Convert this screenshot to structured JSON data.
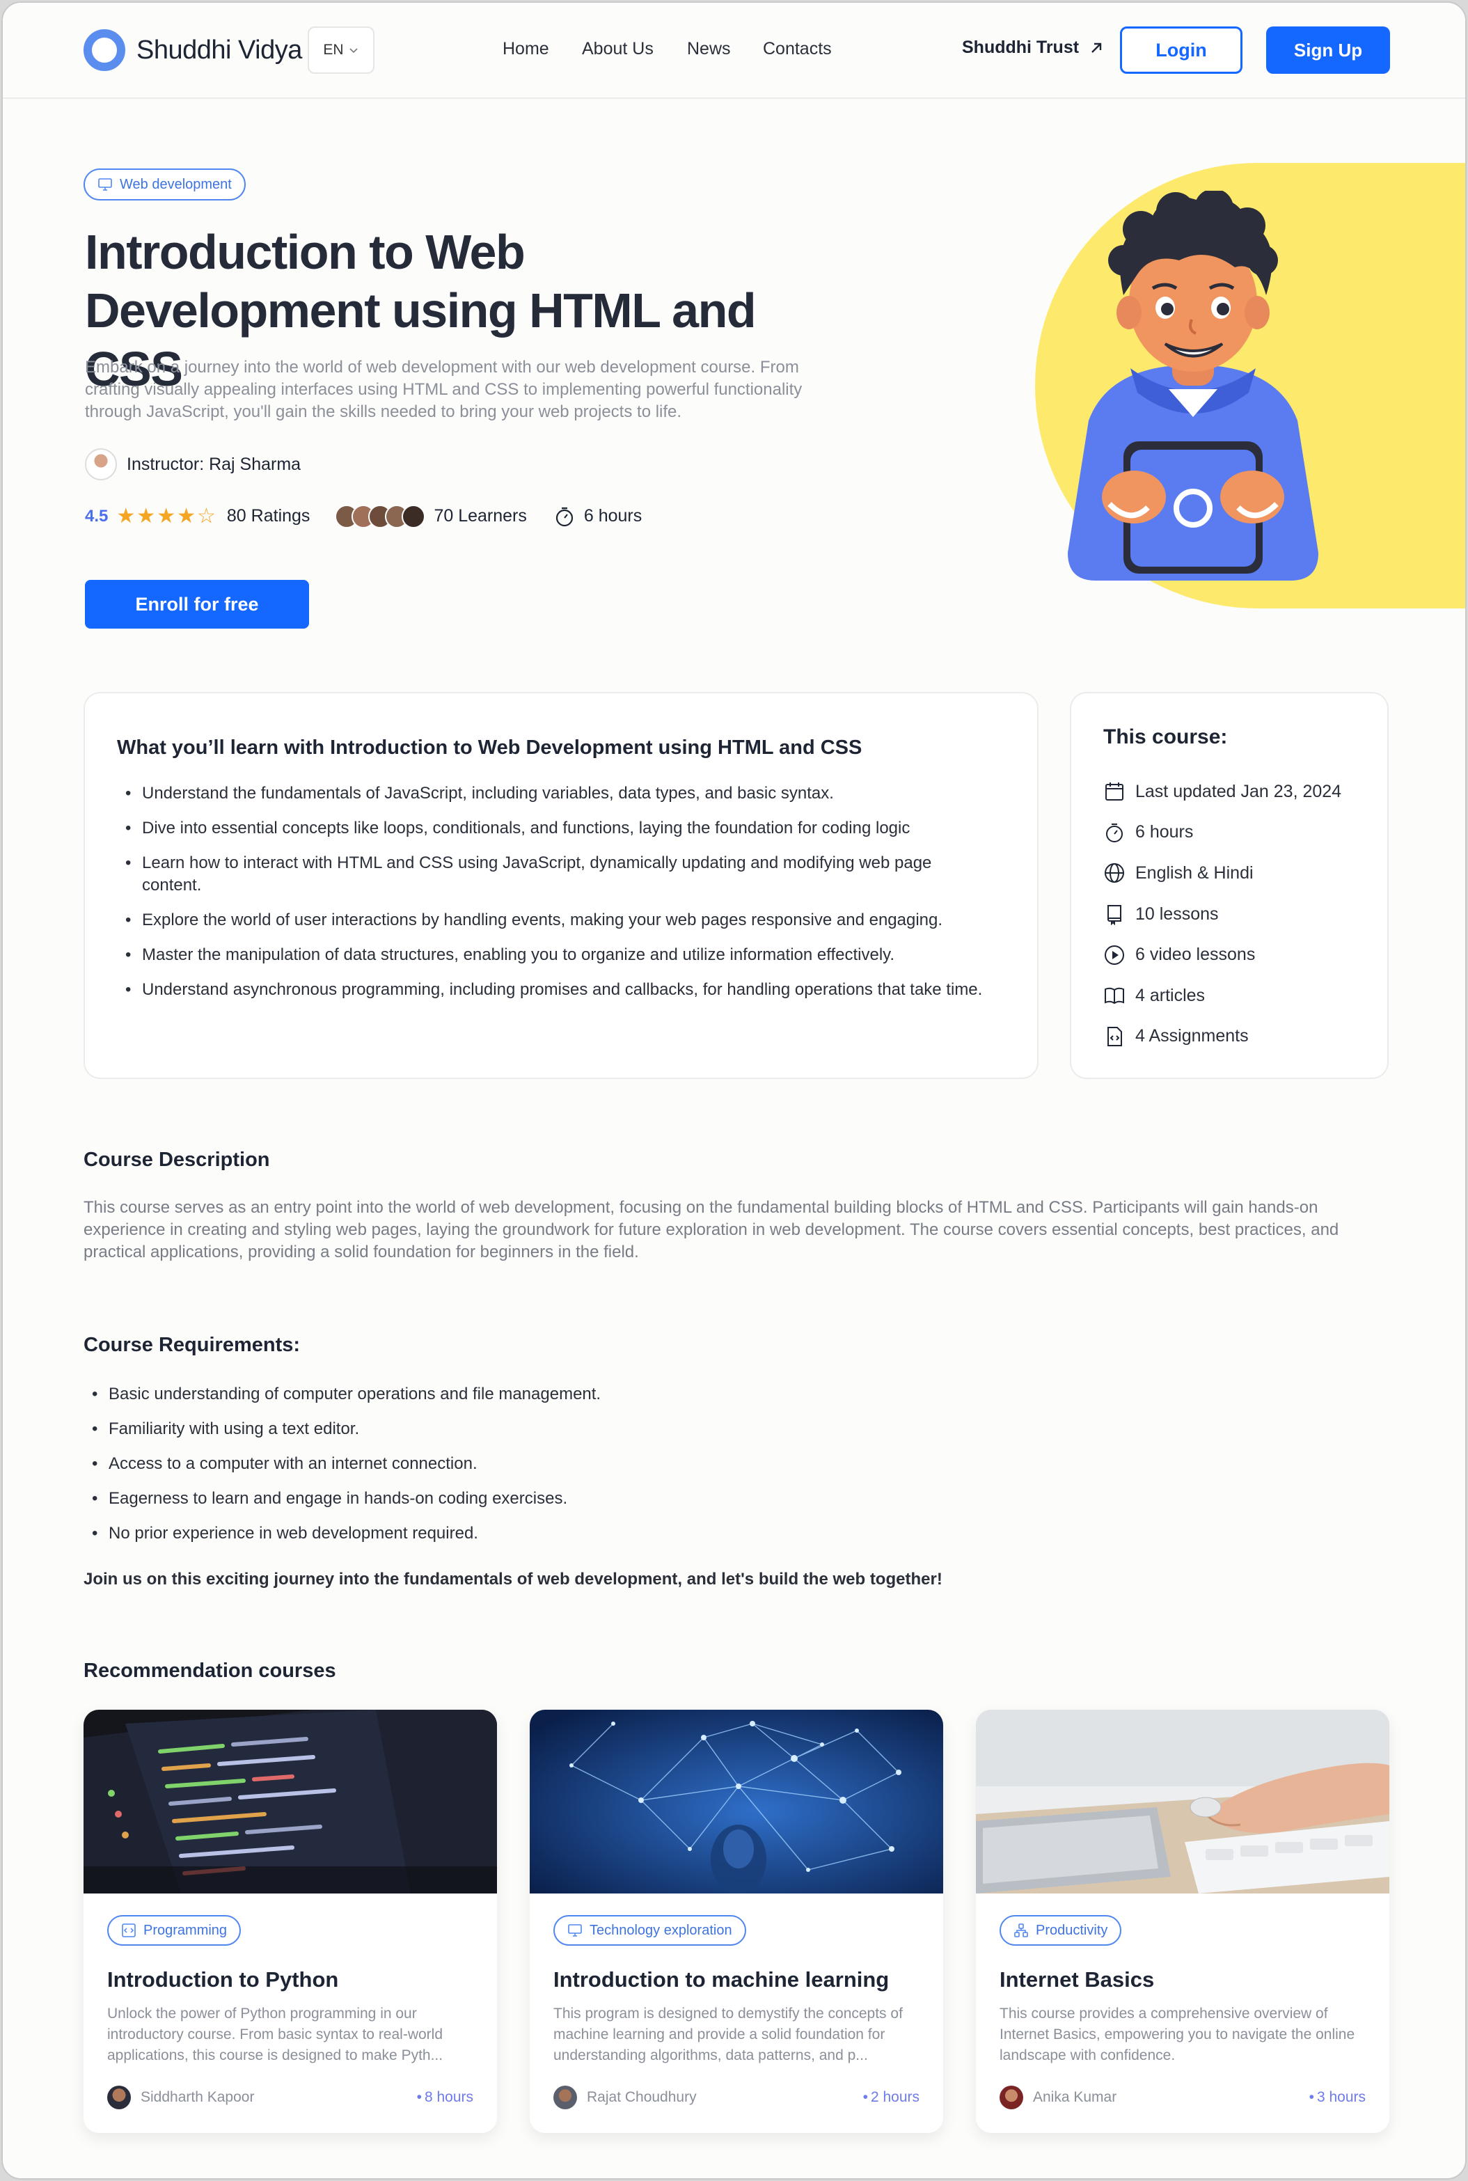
{
  "header": {
    "logo_text": "Shuddhi Vidya",
    "lang": "EN",
    "nav": [
      "Home",
      "About Us",
      "News",
      "Contacts"
    ],
    "trust_link": "Shuddhi Trust",
    "login": "Login",
    "signup": "Sign Up"
  },
  "hero": {
    "category": "Web development",
    "title": "Introduction to Web Development using HTML and CSS",
    "description": "Embark on a journey into the world of web development with our web development course. From crafting visually appealing interfaces using HTML and CSS to implementing powerful functionality through JavaScript, you'll gain the skills needed to bring your web projects to life.",
    "instructor": "Instructor: Raj Sharma",
    "rating": "4.5",
    "ratings_count": "80 Ratings",
    "learners": "70 Learners",
    "duration": "6 hours",
    "enroll": "Enroll for free"
  },
  "learn": {
    "title": "What you’ll learn with Introduction to Web Development using HTML and CSS",
    "items": [
      "Understand the fundamentals of JavaScript, including variables, data types, and basic syntax.",
      "Dive into essential concepts like loops, conditionals, and functions, laying the foundation for coding logic",
      "Learn how to interact with HTML and CSS using JavaScript, dynamically updating and modifying web page content.",
      "Explore the world of user interactions by handling events, making your web pages responsive and engaging.",
      "Master the manipulation of data structures, enabling you to organize and utilize information effectively.",
      "Understand asynchronous programming, including promises and callbacks, for handling operations that take time."
    ]
  },
  "course_info": {
    "title": "This course:",
    "items": [
      {
        "icon": "calendar-icon",
        "text": "Last updated Jan 23, 2024"
      },
      {
        "icon": "stopwatch-icon",
        "text": "6 hours"
      },
      {
        "icon": "globe-icon",
        "text": "English & Hindi"
      },
      {
        "icon": "book-icon",
        "text": "10 lessons"
      },
      {
        "icon": "play-icon",
        "text": "6 video lessons"
      },
      {
        "icon": "open-book-icon",
        "text": "4 articles"
      },
      {
        "icon": "code-file-icon",
        "text": "4 Assignments"
      }
    ]
  },
  "description": {
    "heading": "Course Description",
    "text": "This course serves as an entry point into the world of web development, focusing on the fundamental building blocks of HTML and CSS. Participants will gain hands-on experience in creating and styling web pages, laying the groundwork for future exploration in web development. The course covers essential concepts, best practices, and practical applications, providing a solid foundation for beginners in the field."
  },
  "requirements": {
    "heading": "Course Requirements:",
    "items": [
      "Basic understanding of computer operations and file management.",
      "Familiarity with using a text editor.",
      "Access to a computer with an internet connection.",
      "Eagerness to learn and engage in hands-on coding exercises.",
      "No prior experience in web development required."
    ],
    "closing": "Join us on this exciting journey into the fundamentals of web development, and let's build the web together!"
  },
  "recommendations": {
    "heading": "Recommendation courses",
    "cards": [
      {
        "tag": "Programming",
        "title": "Introduction to Python",
        "desc": "Unlock the power of Python programming in our introductory course. From basic syntax to real-world applications, this course is designed to make Pyth...",
        "author": "Siddharth Kapoor",
        "hours": "8 hours"
      },
      {
        "tag": "Technology exploration",
        "title": "Introduction to machine learning",
        "desc": "This program is designed to demystify the concepts of machine learning and provide a solid foundation for understanding algorithms, data patterns, and p...",
        "author": "Rajat Choudhury",
        "hours": "2 hours"
      },
      {
        "tag": "Productivity",
        "title": "Internet Basics",
        "desc": "This course provides a comprehensive overview of Internet Basics, empowering you to navigate the online landscape with confidence.",
        "author": "Anika Kumar",
        "hours": "3 hours"
      }
    ]
  },
  "colors": {
    "primary": "#1467ff",
    "accent_yellow": "#fde96c",
    "star": "#f5a524"
  }
}
